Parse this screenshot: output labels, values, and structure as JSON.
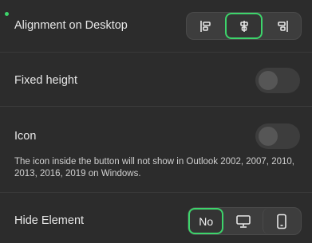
{
  "alignment": {
    "label": "Alignment on Desktop",
    "options": [
      {
        "icon": "align-left-icon"
      },
      {
        "icon": "align-center-icon"
      },
      {
        "icon": "align-right-icon"
      }
    ],
    "selected": "align-center-icon"
  },
  "fixed_height": {
    "label": "Fixed height",
    "enabled": false
  },
  "icon_setting": {
    "label": "Icon",
    "enabled": false,
    "helper": "The icon inside the button will not show in Outlook 2002, 2007, 2010, 2013, 2016, 2019 on Windows."
  },
  "hide_element": {
    "label": "Hide Element",
    "options": [
      {
        "label": "No"
      },
      {
        "icon": "desktop-icon"
      },
      {
        "icon": "mobile-icon"
      }
    ],
    "selected": "No"
  },
  "colors": {
    "accent": "#3dd46b",
    "background": "#2c2c2c",
    "control": "#3d3d3d"
  }
}
